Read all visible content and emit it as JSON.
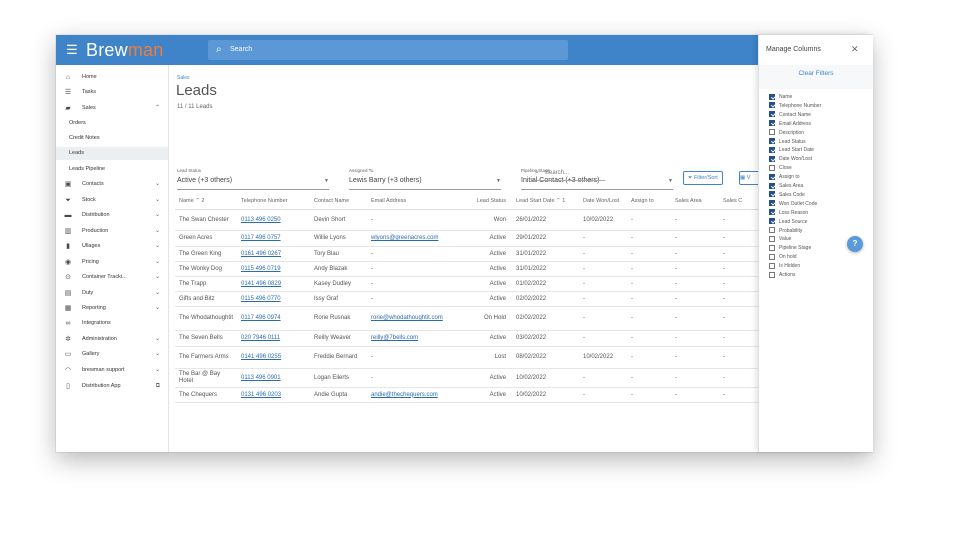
{
  "brand": {
    "part1": "Brew",
    "part2": "man"
  },
  "search": {
    "placeholder": "Search"
  },
  "sidebar": {
    "items": [
      {
        "label": "Home",
        "icon": "home-icon",
        "glyph": "⌂",
        "chevron": ""
      },
      {
        "label": "Tasks",
        "icon": "list-icon",
        "glyph": "☰",
        "chevron": ""
      },
      {
        "label": "Sales",
        "icon": "basket-icon",
        "glyph": "▰",
        "chevron": "⌃"
      },
      {
        "label": "Orders",
        "sub": true
      },
      {
        "label": "Credit Notes",
        "sub": true
      },
      {
        "label": "Leads",
        "sub": true,
        "active": true
      },
      {
        "label": "Leads Pipeline",
        "sub": true
      },
      {
        "label": "Contacts",
        "icon": "contacts-icon",
        "glyph": "▣",
        "chevron": "⌄"
      },
      {
        "label": "Stock",
        "icon": "filter-icon",
        "glyph": "⏷",
        "chevron": "⌄"
      },
      {
        "label": "Distribution",
        "icon": "truck-icon",
        "glyph": "▬",
        "chevron": "⌄"
      },
      {
        "label": "Production",
        "icon": "production-icon",
        "glyph": "▥",
        "chevron": "⌄"
      },
      {
        "label": "Ullages",
        "icon": "ullage-icon",
        "glyph": "▮",
        "chevron": "⌄"
      },
      {
        "label": "Pricing",
        "icon": "pricing-icon",
        "glyph": "◉",
        "chevron": "⌄"
      },
      {
        "label": "Container Tracki...",
        "icon": "target-icon",
        "glyph": "⊙",
        "chevron": "⌄"
      },
      {
        "label": "Duty",
        "icon": "duty-icon",
        "glyph": "▤",
        "chevron": "⌄"
      },
      {
        "label": "Reporting",
        "icon": "report-icon",
        "glyph": "▦",
        "chevron": "⌄"
      },
      {
        "label": "Integrations",
        "icon": "link-icon",
        "glyph": "∞",
        "chevron": ""
      },
      {
        "label": "Administration",
        "icon": "gear-icon",
        "glyph": "✲",
        "chevron": "⌄"
      },
      {
        "label": "Gallery",
        "icon": "gallery-icon",
        "glyph": "▭",
        "chevron": "⌄"
      },
      {
        "label": "brewman support",
        "icon": "support-icon",
        "glyph": "◠",
        "chevron": "⌄"
      },
      {
        "label": "Distribution App",
        "icon": "phone-icon",
        "glyph": "▯",
        "chevron": "⧉"
      }
    ]
  },
  "page": {
    "breadcrumb": "Sales",
    "title": "Leads",
    "count": "11 / 11 Leads"
  },
  "filters": {
    "lead_status": {
      "label": "Lead Status",
      "value": "Active (+3 others)"
    },
    "assigned_to": {
      "label": "Assigned To",
      "value": "Lewis Barry (+3 others)"
    },
    "pipeline_stage": {
      "label": "Pipeline Stage",
      "value": "Initial Contact (+3 others)"
    }
  },
  "toolbar": {
    "search_placeholder": "Search...",
    "filter_sort": "Filter/Sort",
    "view_label": "V"
  },
  "table": {
    "columns": [
      "Name ⌃ 2",
      "Telephone Number",
      "Contact Name",
      "Email Address",
      "Lead Status",
      "Lead Start Date ⌃ 1",
      "Date Won/Lost",
      "Assign to",
      "Sales Area",
      "Sales C"
    ],
    "rows": [
      [
        "The Swan Chester",
        "0113 496 0250",
        "Devin Short",
        "-",
        "Won",
        "26/01/2022",
        "10/02/2022",
        "-",
        "-",
        "-"
      ],
      [
        "Green Acres",
        "0117 496 0757",
        "Willie Lyons",
        "wlyons@greenacres.com",
        "Active",
        "29/01/2022",
        "-",
        "-",
        "-",
        "-"
      ],
      [
        "The Green King",
        "0161 496 0267",
        "Tory Blau",
        "-",
        "Active",
        "31/01/2022",
        "-",
        "-",
        "-",
        "-"
      ],
      [
        "The Wonky Dog",
        "0115 496 0719",
        "Andy Blazak",
        "-",
        "Active",
        "31/01/2022",
        "-",
        "-",
        "-",
        "-"
      ],
      [
        "The Trapp",
        "0141 496 0829",
        "Kasey Dudley",
        "-",
        "Active",
        "01/02/2022",
        "-",
        "-",
        "-",
        "-"
      ],
      [
        "Gifts and Bitz",
        "0115 496 0770",
        "Issy Graf",
        "-",
        "Active",
        "02/02/2022",
        "-",
        "-",
        "-",
        "-"
      ],
      [
        "The Whodathoughtit",
        "0117 496 0974",
        "Rorie Rusnak",
        "rorie@whodathoughtit.com",
        "On Hold",
        "02/02/2022",
        "-",
        "-",
        "-",
        "-"
      ],
      [
        "The Seven Bells",
        "020 7946 0111",
        "Reilly Weaver",
        "reilly@7bells.com",
        "Active",
        "03/02/2022",
        "-",
        "-",
        "-",
        "-"
      ],
      [
        "The Farmers Arms",
        "0141 496 0255",
        "Freddie Bernard",
        "-",
        "Lost",
        "08/02/2022",
        "10/02/2022",
        "-",
        "-",
        "-"
      ],
      [
        "The Bar @ Bay Hotel",
        "0113 496 0901",
        "Logan Eilerts",
        "-",
        "Active",
        "10/02/2022",
        "-",
        "-",
        "-",
        "-"
      ],
      [
        "The Chequers",
        "0131 496 0203",
        "Andie Gupta",
        "andie@thechequers.com",
        "Active",
        "10/02/2022",
        "-",
        "-",
        "-",
        "-"
      ]
    ]
  },
  "manage_columns": {
    "title": "Manage Columns",
    "clear_filters": "Clear Filters",
    "items": [
      {
        "label": "Name",
        "checked": true
      },
      {
        "label": "Telephone Number",
        "checked": true
      },
      {
        "label": "Contact Name",
        "checked": true
      },
      {
        "label": "Email Address",
        "checked": true
      },
      {
        "label": "Description",
        "checked": false
      },
      {
        "label": "Lead Status",
        "checked": true
      },
      {
        "label": "Lead Start Date",
        "checked": true
      },
      {
        "label": "Date Won/Lost",
        "checked": true
      },
      {
        "label": "Close",
        "checked": false
      },
      {
        "label": "Assign to",
        "checked": true
      },
      {
        "label": "Sales Area",
        "checked": true
      },
      {
        "label": "Sales Code",
        "checked": true
      },
      {
        "label": "Won Outlet Code",
        "checked": true
      },
      {
        "label": "Loss Reason",
        "checked": true
      },
      {
        "label": "Lead Source",
        "checked": true
      },
      {
        "label": "Probability",
        "checked": false
      },
      {
        "label": "Value",
        "checked": false
      },
      {
        "label": "Pipeline Stage",
        "checked": false
      },
      {
        "label": "On hold",
        "checked": false
      },
      {
        "label": "Is Hidden",
        "checked": false
      },
      {
        "label": "Actions",
        "checked": false
      }
    ]
  },
  "colors": {
    "topbar": "#3f84c9",
    "brand_accent": "#f07b3a",
    "link": "#2a6cb3",
    "checkbox": "#23518a"
  }
}
